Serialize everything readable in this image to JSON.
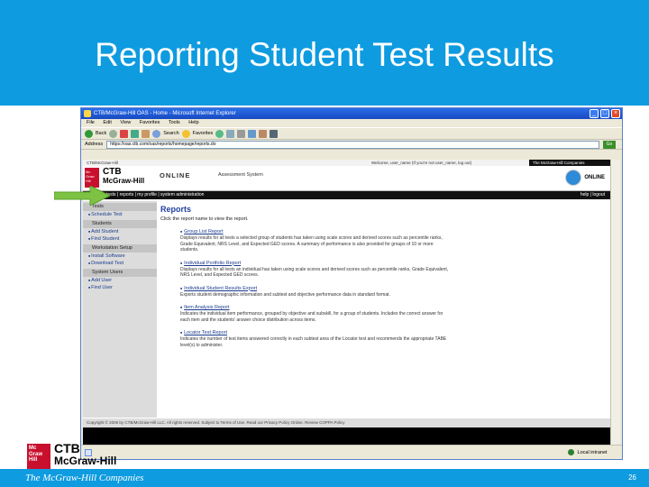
{
  "slide": {
    "title": "Reporting Student Test Results",
    "companies": "The McGraw-Hill Companies",
    "page_number": "26",
    "logo": {
      "ctb": "CTB",
      "mcgraw": "McGraw-Hill",
      "mark": "Mc Graw Hill"
    }
  },
  "browser": {
    "window_title": "CTB/McGraw-Hill OAS - Home - Microsoft Internet Explorer",
    "menu": [
      "File",
      "Edit",
      "View",
      "Favorites",
      "Tools",
      "Help"
    ],
    "toolbar": {
      "back": "Back",
      "search": "Search",
      "favorites": "Favorites"
    },
    "address_label": "Address",
    "address": "https://oas.ctb.com/oas/reports/homepage/reports.do",
    "go": "Go",
    "status": {
      "zone": "Local intranet"
    }
  },
  "app": {
    "notice": "CTB/McGraw-Hill",
    "notice_right": "Welcome, user_name (If you're not user_name, log out)",
    "brand_tag": "The McGraw-Hill Companies",
    "logo_mark": "Mc Graw Hill",
    "logo_ctb": "CTB",
    "logo_mcgraw": "McGraw-Hill",
    "brand": "ONLINE",
    "brand_sub": "Assessment System",
    "online_badge": "ONLINE",
    "nav": "tests | reports | my profile | system administration",
    "nav_right": "help | logout",
    "sidebar": {
      "tests_head": "Tests",
      "tests_links": [
        "Schedule Test"
      ],
      "students_head": "Students",
      "students_links": [
        "Add Student",
        "Find Student"
      ],
      "workstation_head": "Workstation Setup",
      "workstation_links": [
        "Install Software",
        "Download Test"
      ],
      "users_head": "System Users",
      "users_links": [
        "Add User",
        "Find User"
      ]
    },
    "reports_title": "Reports",
    "reports_intro": "Click the report name to view the report.",
    "reports": [
      {
        "name": "Group List Report",
        "desc": "Displays results for all tests a selected group of students has taken using scale scores and derived scores such as percentile ranks, Grade Equivalent, NRS Level, and Expected GED scores. A summary of performance is also provided for groups of 10 or more students."
      },
      {
        "name": "Individual Portfolio Report",
        "desc": "Displays results for all tests an individual has taken using scale scores and derived scores such as percentile ranks, Grade Equivalent, NRS Level, and Expected GED scores."
      },
      {
        "name": "Individual Student Results Export",
        "desc": "Exports student demographic information and subtest and objective performance data in standard format."
      },
      {
        "name": "Item Analysis Report",
        "desc": "Indicates the individual item performance, grouped by objective and subskill, for a group of students. Includes the correct answer for each item and the students' answer choice distribution across items."
      },
      {
        "name": "Locator Test Report",
        "desc": "Indicates the number of test items answered correctly in each subtest area of the Locator test and recommends the appropriate TABE level(s) to administer."
      }
    ],
    "footer": "Copyright © 2006 by CTB/McGraw-Hill LLC. All rights reserved.    Subject to Terms of Use.    Read our Privacy Policy Online.    Review COPPA Policy"
  },
  "colors": {
    "band": "#0e9be0",
    "arrow": "#7dc242",
    "nav": "#111111"
  }
}
